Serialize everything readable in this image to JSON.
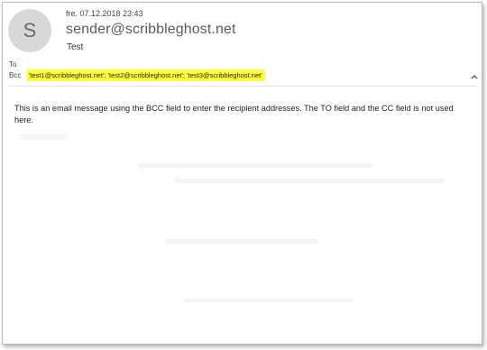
{
  "message": {
    "avatar_initial": "S",
    "date": "fre. 07.12.2018 23:43",
    "sender": "sender@scribbleghost.net",
    "subject": "Test",
    "to_label": "To",
    "bcc_label": "Bcc",
    "bcc_recipients": "'test1@scribbleghost.net'; 'test2@scribbleghost.net'; 'test3@scribbleghost.net'",
    "highlight_color": "#fdff3a",
    "body": "This is an email message using the BCC field to enter the recipient addresses. The TO field and the CC field is not used here."
  },
  "icons": {
    "collapse": "chevron-up-icon"
  }
}
